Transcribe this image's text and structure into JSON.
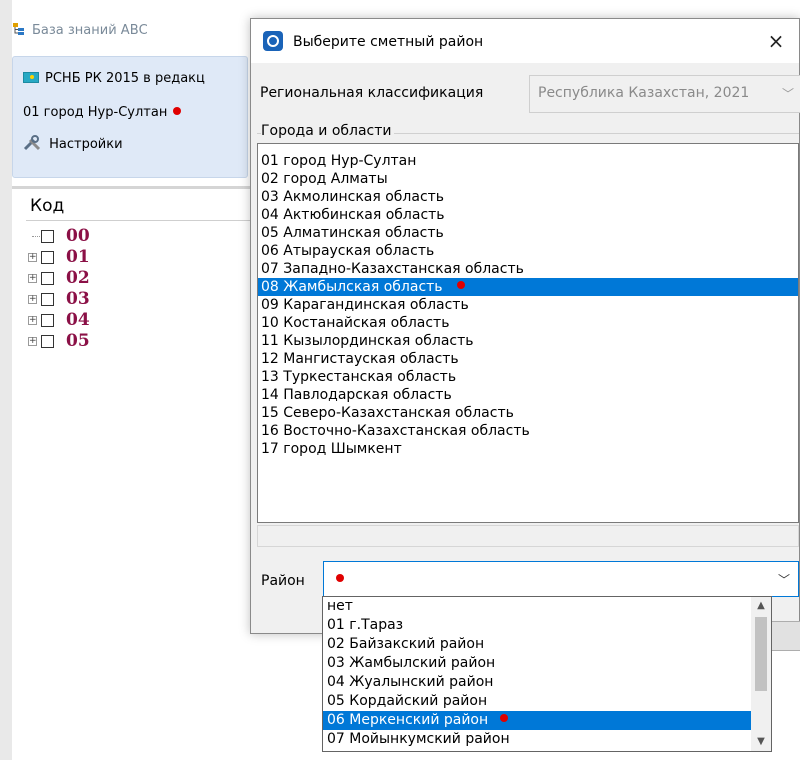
{
  "app": {
    "title": "База знаний АВС",
    "norm_base": "РСНБ РК 2015 в редакц",
    "current_region": "01 город Нур-Султан",
    "settings_label": "Настройки",
    "code_header": "Код",
    "tree_codes": [
      "00",
      "01",
      "02",
      "03",
      "04",
      "05"
    ]
  },
  "dialog": {
    "title": "Выберите сметный район",
    "close_label": "×",
    "regional_classification_label": "Региональная классификация",
    "regional_classification_value": "Республика Казахстан, 2021",
    "group_label": "Города и области",
    "cities": [
      "01 город Нур-Султан",
      "02 город Алматы",
      "03 Акмолинская область",
      "04 Актюбинская область",
      "05 Алматинская область",
      "06 Атырауская область",
      "07 Западно-Казахстанская область",
      "08 Жамбылская область",
      "09 Карагандинская область",
      "10 Костанайская область",
      "11 Кызылординская область",
      "12 Мангистауская область",
      "13 Туркестанская область",
      "14 Павлодарская область",
      "15 Северо-Казахстанская область",
      "16 Восточно-Казахстанская область",
      "17 город Шымкент"
    ],
    "selected_city_index": 7,
    "district_label": "Район",
    "district_options": [
      "нет",
      "01 г.Тараз",
      "02 Байзакский район",
      "03 Жамбылский район",
      "04 Жуалынский район",
      "05 Кордайский район",
      "06 Меркенский район",
      "07 Мойынкумский район"
    ],
    "selected_district_index": 6
  },
  "colors": {
    "selection": "#0078d7",
    "marker_dot": "#e00000",
    "code_text": "#8b1046"
  }
}
